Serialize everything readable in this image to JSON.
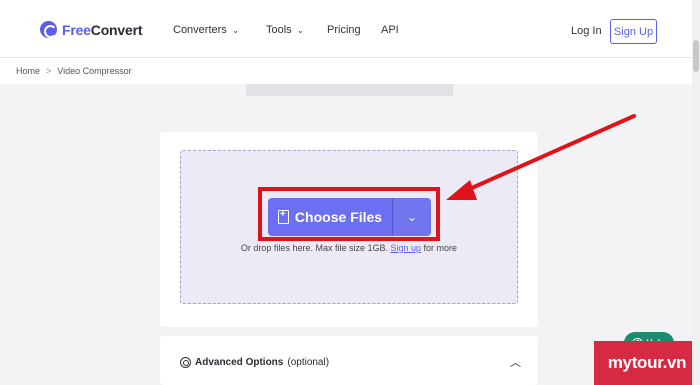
{
  "header": {
    "logo_free": "Free",
    "logo_convert": "Convert",
    "nav": [
      {
        "label": "Converters",
        "dropdown": true
      },
      {
        "label": "Tools",
        "dropdown": true
      },
      {
        "label": "Pricing",
        "dropdown": false
      },
      {
        "label": "API",
        "dropdown": false
      }
    ],
    "login_label": "Log In",
    "signup_label": "Sign Up"
  },
  "breadcrumb": {
    "home": "Home",
    "separator": ">",
    "current": "Video Compressor"
  },
  "upload": {
    "choose_files_label": "Choose Files",
    "note_prefix": "Or drop files here. Max file size 1GB.",
    "note_link": "Sign up",
    "note_suffix": "for more"
  },
  "advanced": {
    "label_bold": "Advanced Options",
    "label_optional": "(optional)"
  },
  "help": {
    "label": "Help"
  },
  "watermark": {
    "text": "mytour.vn"
  },
  "colors": {
    "brand": "#5b5fe6",
    "button": "#6c6ff0",
    "highlight": "#e1121a",
    "help": "#1d8b6d",
    "watermark": "#d62a42"
  }
}
